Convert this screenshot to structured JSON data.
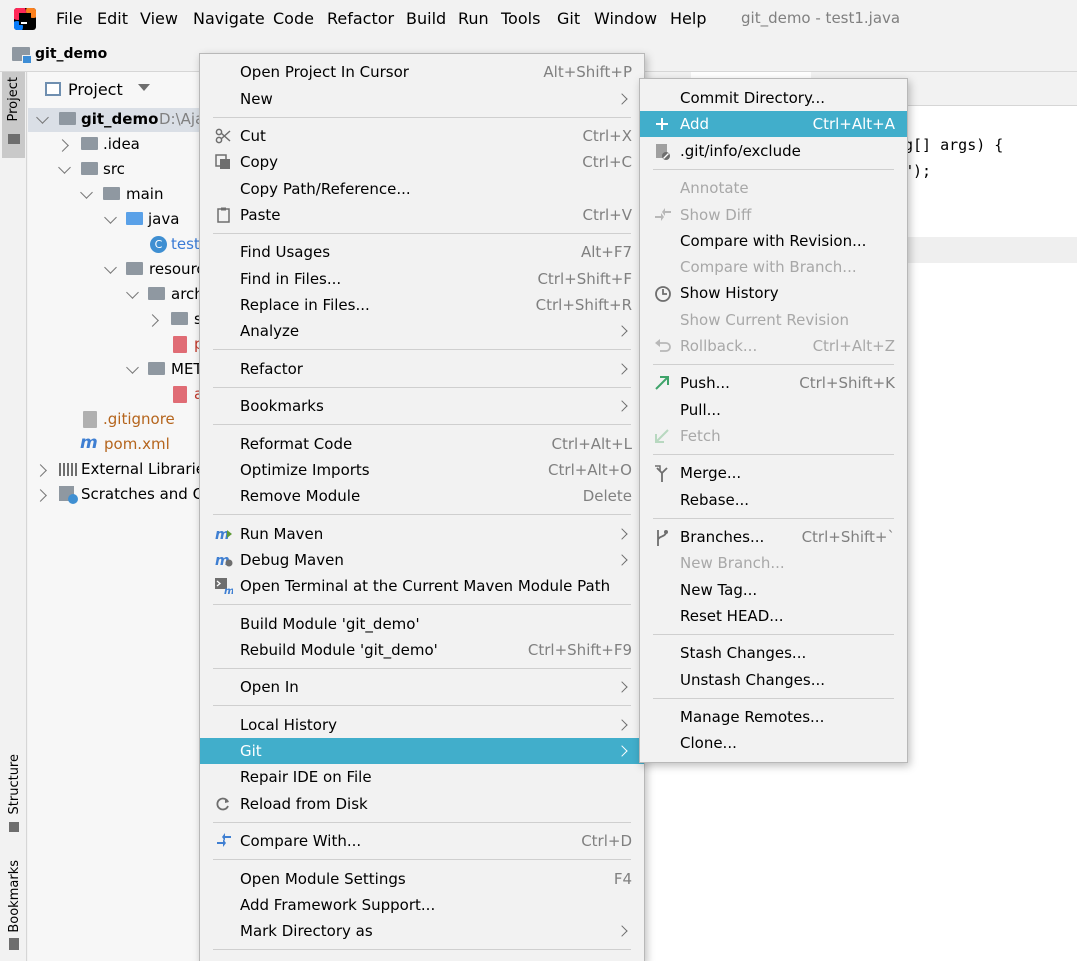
{
  "app": {
    "window_title": "git_demo - test1.java",
    "menu": [
      "File",
      "Edit",
      "View",
      "Navigate",
      "Code",
      "Refactor",
      "Build",
      "Run",
      "Tools",
      "Git",
      "Window",
      "Help"
    ]
  },
  "navbar": {
    "project_label": "git_demo"
  },
  "left_strip": {
    "project": "Project",
    "structure": "Structure",
    "bookmarks": "Bookmarks"
  },
  "project_panel": {
    "header": "Project",
    "tree": {
      "root_name": "git_demo",
      "root_path": "D:\\Aja",
      "idea": ".idea",
      "src": "src",
      "main": "main",
      "java": "java",
      "test_class": "test",
      "resources": "resourc",
      "arch": "arch",
      "s": "s",
      "p": "p",
      "meta": "MET",
      "a": "a",
      "gitignore": ".gitignore",
      "pom": "pom.xml",
      "external": "External Librarie",
      "scratches": "Scratches and Co"
    }
  },
  "editor": {
    "line1": "g[] args) {",
    "line2": "\");"
  },
  "context_menu": {
    "items": [
      {
        "label": "Open Project In Cursor",
        "shortcut": "Alt+Shift+P"
      },
      {
        "label": "New"
      },
      {
        "label": "Cut",
        "shortcut": "Ctrl+X"
      },
      {
        "label": "Copy",
        "shortcut": "Ctrl+C"
      },
      {
        "label": "Copy Path/Reference..."
      },
      {
        "label": "Paste",
        "shortcut": "Ctrl+V"
      },
      {
        "label": "Find Usages",
        "shortcut": "Alt+F7"
      },
      {
        "label": "Find in Files...",
        "shortcut": "Ctrl+Shift+F"
      },
      {
        "label": "Replace in Files...",
        "shortcut": "Ctrl+Shift+R"
      },
      {
        "label": "Analyze"
      },
      {
        "label": "Refactor"
      },
      {
        "label": "Bookmarks"
      },
      {
        "label": "Reformat Code",
        "shortcut": "Ctrl+Alt+L"
      },
      {
        "label": "Optimize Imports",
        "shortcut": "Ctrl+Alt+O"
      },
      {
        "label": "Remove Module",
        "shortcut": "Delete"
      },
      {
        "label": "Run Maven"
      },
      {
        "label": "Debug Maven"
      },
      {
        "label": "Open Terminal at the Current Maven Module Path"
      },
      {
        "label": "Build Module 'git_demo'"
      },
      {
        "label": "Rebuild Module 'git_demo'",
        "shortcut": "Ctrl+Shift+F9"
      },
      {
        "label": "Open In"
      },
      {
        "label": "Local History"
      },
      {
        "label": "Git"
      },
      {
        "label": "Repair IDE on File"
      },
      {
        "label": "Reload from Disk"
      },
      {
        "label": "Compare With...",
        "shortcut": "Ctrl+D"
      },
      {
        "label": "Open Module Settings",
        "shortcut": "F4"
      },
      {
        "label": "Add Framework Support..."
      },
      {
        "label": "Mark Directory as"
      }
    ]
  },
  "git_submenu": {
    "items": [
      {
        "label": "Commit Directory..."
      },
      {
        "label": "Add",
        "shortcut": "Ctrl+Alt+A"
      },
      {
        "label": ".git/info/exclude"
      },
      {
        "label": "Annotate"
      },
      {
        "label": "Show Diff"
      },
      {
        "label": "Compare with Revision..."
      },
      {
        "label": "Compare with Branch..."
      },
      {
        "label": "Show History"
      },
      {
        "label": "Show Current Revision"
      },
      {
        "label": "Rollback...",
        "shortcut": "Ctrl+Alt+Z"
      },
      {
        "label": "Push...",
        "shortcut": "Ctrl+Shift+K"
      },
      {
        "label": "Pull..."
      },
      {
        "label": "Fetch"
      },
      {
        "label": "Merge..."
      },
      {
        "label": "Rebase..."
      },
      {
        "label": "Branches...",
        "shortcut": "Ctrl+Shift+`"
      },
      {
        "label": "New Branch..."
      },
      {
        "label": "New Tag..."
      },
      {
        "label": "Reset HEAD..."
      },
      {
        "label": "Stash Changes..."
      },
      {
        "label": "Unstash Changes..."
      },
      {
        "label": "Manage Remotes..."
      },
      {
        "label": "Clone..."
      }
    ]
  },
  "colors": {
    "selection": "#41aecb",
    "menu_bg": "#f2f2f2",
    "disabled_text": "#a8a8a8"
  }
}
